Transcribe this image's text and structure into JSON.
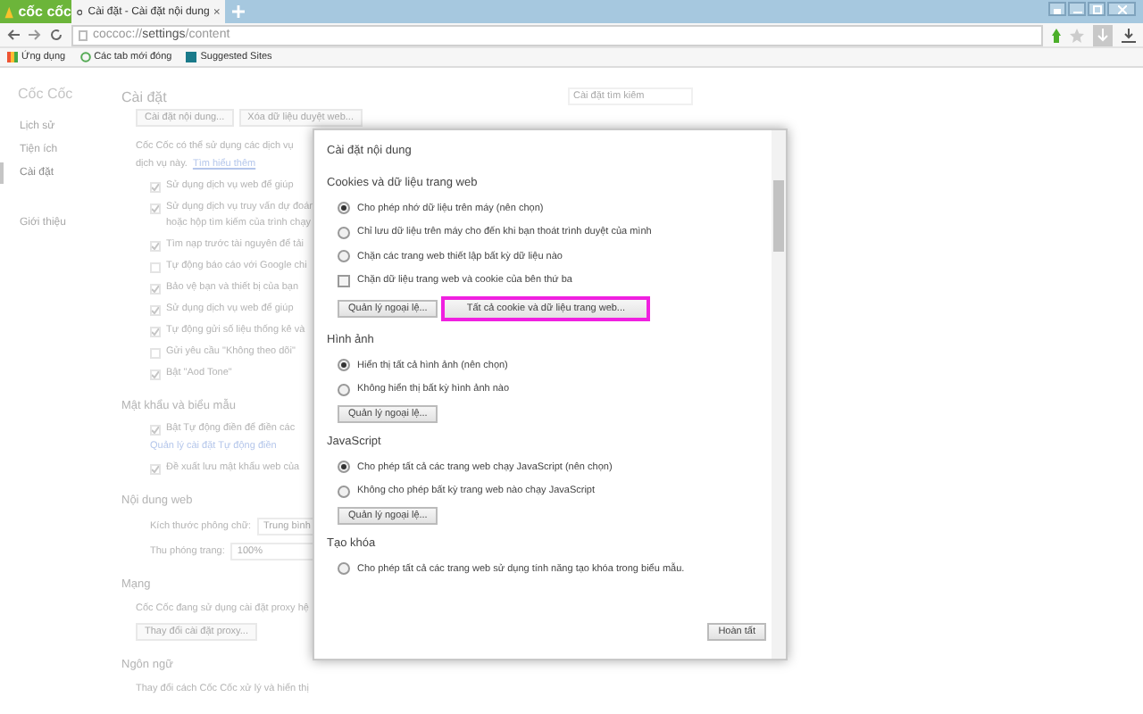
{
  "browser": {
    "logo": "cốc cốc",
    "tab": {
      "title": "Cài đặt - Cài đặt nội dung"
    },
    "url": {
      "scheme": "coccoc://",
      "path": "settings",
      "rest": "/content"
    },
    "bookmarks": [
      {
        "kind": "apps",
        "label": "Ứng dụng"
      },
      {
        "kind": "recent",
        "label": "Các tab mới đóng"
      },
      {
        "kind": "site",
        "label": "Suggested Sites"
      }
    ]
  },
  "sidebar": {
    "title": "Cốc Cốc",
    "items": [
      {
        "label": "Lịch sử",
        "selected": false
      },
      {
        "label": "Tiện ích",
        "selected": false
      },
      {
        "label": "Cài đặt",
        "selected": true
      },
      {
        "label": "Giới thiệu",
        "selected": false
      }
    ]
  },
  "settings": {
    "title": "Cài đặt",
    "search_placeholder": "Cài đặt tìm kiếm",
    "blocks": [
      {
        "kind": "buttons",
        "items": [
          "Cài đặt nội dung...",
          "Xóa dữ liệu duyệt web..."
        ]
      },
      {
        "kind": "text",
        "text": "Cốc Cốc có thể sử dụng các dịch vụ"
      },
      {
        "kind": "text_link",
        "text": "dịch vụ này.",
        "link": "Tìm hiểu thêm"
      },
      {
        "kind": "check",
        "lines": [
          "Sử dụng dịch vụ web để giúp"
        ],
        "checked": true
      },
      {
        "kind": "check",
        "lines": [
          "Sử dụng dịch vụ truy vấn dự đoán",
          "hoặc hộp tìm kiếm của trình chạy"
        ],
        "checked": true
      },
      {
        "kind": "check",
        "lines": [
          "Tìm nạp trước tài nguyên để tải"
        ],
        "checked": true
      },
      {
        "kind": "check",
        "lines": [
          "Tự động báo cáo với Google chi"
        ],
        "checked": false
      },
      {
        "kind": "check",
        "lines": [
          "Bảo vệ bạn và thiết bị của bạn"
        ],
        "checked": true
      },
      {
        "kind": "check",
        "lines": [
          "Sử dụng dịch vụ web để giúp"
        ],
        "checked": true
      },
      {
        "kind": "check",
        "lines": [
          "Tự động gửi số liệu thống kê và"
        ],
        "checked": true
      },
      {
        "kind": "check",
        "lines": [
          "Gửi yêu cầu \"Không theo dõi\""
        ],
        "checked": false
      },
      {
        "kind": "check",
        "lines": [
          "Bật \"Aod Tone\""
        ],
        "checked": true
      },
      {
        "kind": "heading",
        "text": "Mật khẩu và biểu mẫu"
      },
      {
        "kind": "check",
        "lines": [
          "Bật Tự động điền để điền các"
        ],
        "checked": true
      },
      {
        "kind": "link",
        "text": "Quản lý cài đặt Tự động điền"
      },
      {
        "kind": "check",
        "lines": [
          "Đề xuất lưu mật khẩu web của"
        ],
        "checked": true
      },
      {
        "kind": "heading",
        "text": "Nội dung web"
      },
      {
        "kind": "select",
        "label": "Kích thước phông chữ:",
        "value": "Trung bình"
      },
      {
        "kind": "select",
        "label": "Thu phóng trang:",
        "value": "100%"
      },
      {
        "kind": "heading",
        "text": "Mạng"
      },
      {
        "kind": "text",
        "text": "Cốc Cốc đang sử dụng cài đặt proxy hệ"
      },
      {
        "kind": "button",
        "text": "Thay đổi cài đặt proxy..."
      },
      {
        "kind": "heading",
        "text": "Ngôn ngữ"
      },
      {
        "kind": "text",
        "text": "Thay đổi cách Cốc Cốc xử lý và hiển thị"
      }
    ]
  },
  "dialog": {
    "title": "Cài đặt nội dung",
    "sections": [
      {
        "heading": "Cookies và dữ liệu trang web",
        "options": [
          {
            "kind": "radio",
            "label": "Cho phép nhớ dữ liệu trên máy (nên chọn)",
            "selected": true
          },
          {
            "kind": "radio",
            "label": "Chỉ lưu dữ liệu trên máy cho đến khi bạn thoát trình duyệt của mình",
            "selected": false
          },
          {
            "kind": "radio",
            "label": "Chặn các trang web thiết lập bất kỳ dữ liệu nào",
            "selected": false
          },
          {
            "kind": "checkbox",
            "label": "Chặn dữ liệu trang web và cookie của bên thứ ba",
            "checked": false
          }
        ],
        "buttons": [
          {
            "label": "Quản lý ngoại lệ...",
            "highlighted": false
          },
          {
            "label": "Tất cả cookie và dữ liệu trang web...",
            "highlighted": true
          }
        ]
      },
      {
        "heading": "Hình ảnh",
        "options": [
          {
            "kind": "radio",
            "label": "Hiển thị tất cả hình ảnh (nên chọn)",
            "selected": true
          },
          {
            "kind": "radio",
            "label": "Không hiển thị bất kỳ hình ảnh nào",
            "selected": false
          }
        ],
        "buttons": [
          {
            "label": "Quản lý ngoại lệ...",
            "highlighted": false
          }
        ]
      },
      {
        "heading": "JavaScript",
        "options": [
          {
            "kind": "radio",
            "label": "Cho phép tất cả các trang web chạy JavaScript (nên chọn)",
            "selected": true
          },
          {
            "kind": "radio",
            "label": "Không cho phép bất kỳ trang web nào chạy JavaScript",
            "selected": false
          }
        ],
        "buttons": [
          {
            "label": "Quản lý ngoại lệ...",
            "highlighted": false
          }
        ]
      },
      {
        "heading": "Tạo khóa",
        "options": [
          {
            "kind": "radio",
            "label": "Cho phép tất cả các trang web sử dụng tính năng tạo khóa trong biểu mẫu.",
            "selected": false
          }
        ]
      }
    ],
    "done": "Hoàn tất"
  }
}
